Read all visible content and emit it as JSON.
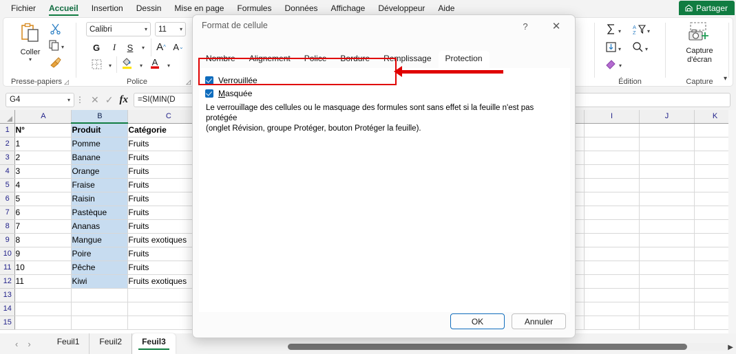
{
  "ribbon": {
    "tabs": [
      {
        "label": "Fichier",
        "active": false
      },
      {
        "label": "Accueil",
        "active": true
      },
      {
        "label": "Insertion",
        "active": false
      },
      {
        "label": "Dessin",
        "active": false
      },
      {
        "label": "Mise en page",
        "active": false
      },
      {
        "label": "Formules",
        "active": false
      },
      {
        "label": "Données",
        "active": false
      },
      {
        "label": "Affichage",
        "active": false
      },
      {
        "label": "Développeur",
        "active": false
      },
      {
        "label": "Aide",
        "active": false
      }
    ],
    "share_label": "Partager",
    "groups": {
      "clipboard": {
        "label": "Presse-papiers",
        "paste_label": "Coller"
      },
      "font": {
        "label": "Police",
        "font_name": "Calibri",
        "font_size": "11",
        "bold": "G",
        "italic": "I",
        "underline": "S",
        "grow_font": "A",
        "shrink_font": "A"
      },
      "edition": {
        "label": "Édition"
      },
      "capture": {
        "label": "Capture",
        "button_label_line1": "Capture",
        "button_label_line2": "d'écran"
      }
    }
  },
  "formula_bar": {
    "name_box": "G4",
    "formula": "=SI(MIN(D",
    "cancel_icon": "cancel-icon",
    "accept_icon": "accept-icon",
    "fx_label": "fx"
  },
  "sheet": {
    "columns": [
      "A",
      "B",
      "C",
      "I",
      "J",
      "K"
    ],
    "selected_column": "B",
    "row_numbers": [
      "1",
      "2",
      "3",
      "4",
      "5",
      "6",
      "7",
      "8",
      "9",
      "10",
      "11",
      "12",
      "13",
      "14",
      "15"
    ],
    "headers": [
      "N°",
      "Produit",
      "Catégorie"
    ],
    "rows": [
      [
        "1",
        "Pomme",
        "Fruits"
      ],
      [
        "2",
        "Banane",
        "Fruits"
      ],
      [
        "3",
        "Orange",
        "Fruits"
      ],
      [
        "4",
        "Fraise",
        "Fruits"
      ],
      [
        "5",
        "Raisin",
        "Fruits"
      ],
      [
        "6",
        "Pastèque",
        "Fruits"
      ],
      [
        "7",
        "Ananas",
        "Fruits"
      ],
      [
        "8",
        "Mangue",
        "Fruits exotiques"
      ],
      [
        "9",
        "Poire",
        "Fruits"
      ],
      [
        "10",
        "Pêche",
        "Fruits"
      ],
      [
        "11",
        "Kiwi",
        "Fruits exotiques"
      ],
      [
        "",
        "",
        ""
      ],
      [
        "",
        "",
        ""
      ],
      [
        "",
        "",
        ""
      ]
    ]
  },
  "sheet_tabs": {
    "prev_icon": "chevron-left-icon",
    "next_icon": "chevron-right-icon",
    "tabs": [
      {
        "label": "Feuil1",
        "active": false
      },
      {
        "label": "Feuil2",
        "active": false
      },
      {
        "label": "Feuil3",
        "active": true
      }
    ]
  },
  "dialog": {
    "title": "Format de cellule",
    "help_icon": "help-icon",
    "close_icon": "close-icon",
    "tabs": [
      {
        "label": "Nombre",
        "active": false
      },
      {
        "label": "Alignement",
        "active": false
      },
      {
        "label": "Police",
        "active": false
      },
      {
        "label": "Bordure",
        "active": false
      },
      {
        "label": "Remplissage",
        "active": false
      },
      {
        "label": "Protection",
        "active": true
      }
    ],
    "checkboxes": [
      {
        "label": "Verrouillée",
        "accelerator": "V",
        "rest": "errouillée",
        "checked": true
      },
      {
        "label": "Masquée",
        "accelerator": "M",
        "rest": "asquée",
        "checked": true
      }
    ],
    "description_line1": "Le verrouillage des cellules ou le masquage des formules sont sans effet si la feuille n'est pas protégée",
    "description_line2": "(onglet Révision, groupe Protéger, bouton Protéger la feuille).",
    "ok_label": "OK",
    "cancel_label": "Annuler"
  },
  "annotation": {
    "highlight_color": "#e00000",
    "arrow_icon": "left-arrow-annotation"
  },
  "colors": {
    "accent_green": "#107c41",
    "selection_blue": "#c7dcf0",
    "focus_blue": "#0f6cbd"
  }
}
